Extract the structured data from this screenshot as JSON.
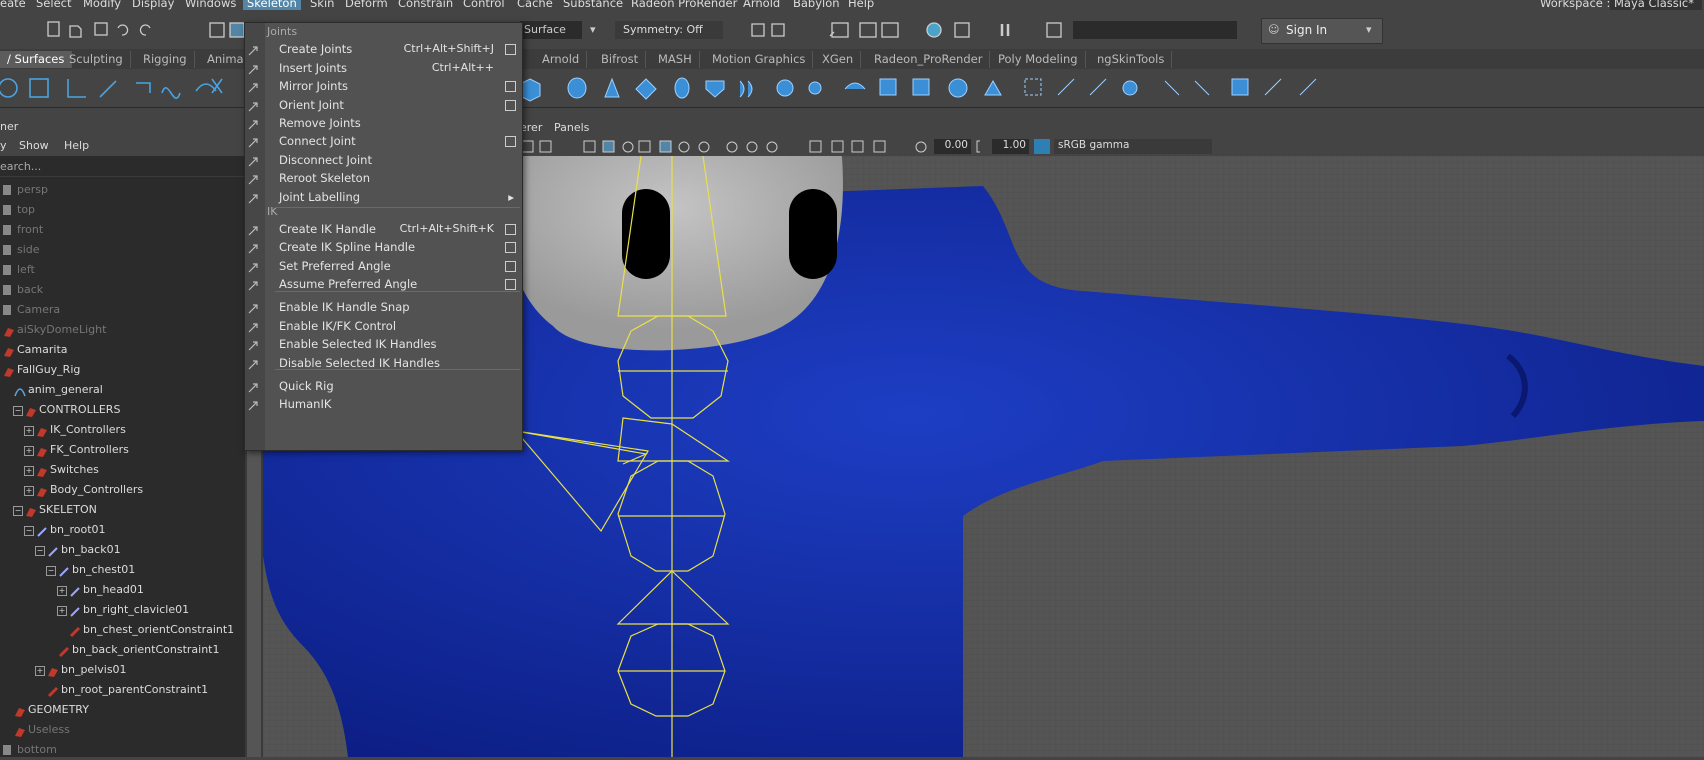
{
  "menubar": {
    "items": [
      "eate",
      "Select",
      "Modify",
      "Display",
      "Windows",
      "Skeleton",
      "Skin",
      "Deform",
      "Constrain",
      "Control",
      "Cache",
      "Substance",
      "Radeon ProRender",
      "Arnold",
      "Babylon",
      "Help"
    ],
    "workspace_label": "Workspace :",
    "workspace_value": "Maya Classic*"
  },
  "statusline": {
    "surface_label": "Surface",
    "symmetry": "Symmetry: Off",
    "sign_in": "Sign In"
  },
  "shelf_tabs": [
    "/ Surfaces",
    "Sculpting",
    "Rigging",
    "Anima",
    "Arnold",
    "Bifrost",
    "MASH",
    "Motion Graphics",
    "XGen",
    "Radeon_ProRender",
    "Poly Modeling",
    "ngSkinTools"
  ],
  "outliner": {
    "header": "ner",
    "menus": [
      "y",
      "Show",
      "Help"
    ],
    "search_placeholder": "earch...",
    "rows": [
      {
        "label": "persp",
        "dim": true,
        "indent": 14
      },
      {
        "label": "top",
        "dim": true,
        "indent": 14
      },
      {
        "label": "front",
        "dim": true,
        "indent": 14
      },
      {
        "label": "side",
        "dim": true,
        "indent": 14
      },
      {
        "label": "left",
        "dim": true,
        "indent": 14
      },
      {
        "label": "back",
        "dim": true,
        "indent": 14
      },
      {
        "label": "Camera",
        "dim": true,
        "indent": 14
      },
      {
        "label": "aiSkyDomeLight",
        "dim": true,
        "indent": 14
      },
      {
        "label": "Camarita",
        "dim": false,
        "indent": 14
      },
      {
        "label": "FallGuy_Rig",
        "dim": false,
        "indent": 14
      },
      {
        "label": "anim_general",
        "dim": false,
        "indent": 25
      },
      {
        "label": "CONTROLLERS",
        "dim": false,
        "indent": 36
      },
      {
        "label": "IK_Controllers",
        "dim": false,
        "indent": 47
      },
      {
        "label": "FK_Controllers",
        "dim": false,
        "indent": 47
      },
      {
        "label": "Switches",
        "dim": false,
        "indent": 47
      },
      {
        "label": "Body_Controllers",
        "dim": false,
        "indent": 47
      },
      {
        "label": "SKELETON",
        "dim": false,
        "indent": 36
      },
      {
        "label": "bn_root01",
        "dim": false,
        "indent": 47
      },
      {
        "label": "bn_back01",
        "dim": false,
        "indent": 58
      },
      {
        "label": "bn_chest01",
        "dim": false,
        "indent": 69
      },
      {
        "label": "bn_head01",
        "dim": false,
        "indent": 80
      },
      {
        "label": "bn_right_clavicle01",
        "dim": false,
        "indent": 80
      },
      {
        "label": "bn_chest_orientConstraint1",
        "dim": false,
        "indent": 80
      },
      {
        "label": "bn_back_orientConstraint1",
        "dim": false,
        "indent": 69
      },
      {
        "label": "bn_pelvis01",
        "dim": false,
        "indent": 58
      },
      {
        "label": "bn_root_parentConstraint1",
        "dim": false,
        "indent": 58
      },
      {
        "label": "GEOMETRY",
        "dim": false,
        "indent": 25
      },
      {
        "label": "Useless",
        "dim": true,
        "indent": 25
      },
      {
        "label": "bottom",
        "dim": true,
        "indent": 14
      }
    ]
  },
  "viewport": {
    "menus": [
      "erer",
      "Panels"
    ],
    "field1": "0.00",
    "field2": "1.00",
    "colorspace": "sRGB gamma"
  },
  "skeleton_menu": {
    "section_joints": "Joints",
    "section_ik": "IK",
    "items": [
      {
        "label": "Create Joints",
        "shortcut": "Ctrl+Alt+Shift+J",
        "box": true
      },
      {
        "label": "Insert Joints",
        "shortcut": "Ctrl+Alt++",
        "box": false
      },
      {
        "label": "Mirror Joints",
        "shortcut": "",
        "box": true
      },
      {
        "label": "Orient Joint",
        "shortcut": "",
        "box": true
      },
      {
        "label": "Remove Joints",
        "shortcut": "",
        "box": false
      },
      {
        "label": "Connect Joint",
        "shortcut": "",
        "box": true
      },
      {
        "label": "Disconnect Joint",
        "shortcut": "",
        "box": false
      },
      {
        "label": "Reroot Skeleton",
        "shortcut": "",
        "box": false
      },
      {
        "label": "Joint Labelling",
        "shortcut": "",
        "box": false,
        "submenu": true
      },
      {
        "label": "Create IK Handle",
        "shortcut": "Ctrl+Alt+Shift+K",
        "box": true
      },
      {
        "label": "Create IK Spline Handle",
        "shortcut": "",
        "box": true
      },
      {
        "label": "Set Preferred Angle",
        "shortcut": "",
        "box": true
      },
      {
        "label": "Assume Preferred Angle",
        "shortcut": "",
        "box": true
      },
      {
        "label": "Enable IK Handle Snap",
        "shortcut": "",
        "box": false
      },
      {
        "label": "Enable IK/FK Control",
        "shortcut": "",
        "box": false
      },
      {
        "label": "Enable Selected IK Handles",
        "shortcut": "",
        "box": false
      },
      {
        "label": "Disable Selected IK Handles",
        "shortcut": "",
        "box": false
      },
      {
        "label": "Quick Rig",
        "shortcut": "",
        "box": false
      },
      {
        "label": "HumanIK",
        "shortcut": "",
        "box": false
      }
    ]
  },
  "colors": {
    "accent": "#5285a6",
    "mesh": "#1a33b8",
    "joint": "#e8e04a"
  }
}
